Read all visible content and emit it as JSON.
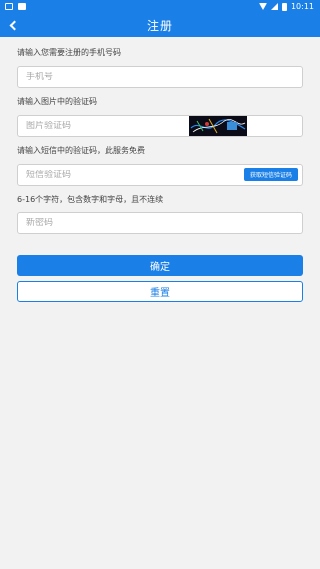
{
  "status_bar": {
    "time": "10:11",
    "icons": [
      "notification-icon",
      "image-icon",
      "wifi-icon",
      "signal-icon",
      "battery-icon"
    ]
  },
  "header": {
    "title": "注册",
    "back_icon": "chevron-left-icon"
  },
  "form": {
    "phone": {
      "label": "请输入您需要注册的手机号码",
      "placeholder": "手机号"
    },
    "captcha": {
      "label": "请输入图片中的验证码",
      "placeholder": "图片验证码"
    },
    "sms": {
      "label": "请输入短信中的验证码，此服务免费",
      "placeholder": "短信验证码",
      "button": "获取短信验证码"
    },
    "password": {
      "label": "6-16个字符，包含数字和字母，且不连续",
      "placeholder": "新密码"
    }
  },
  "actions": {
    "confirm": "确定",
    "reset": "重置"
  },
  "colors": {
    "primary": "#1a7fe6",
    "background": "#f2f2f2"
  }
}
